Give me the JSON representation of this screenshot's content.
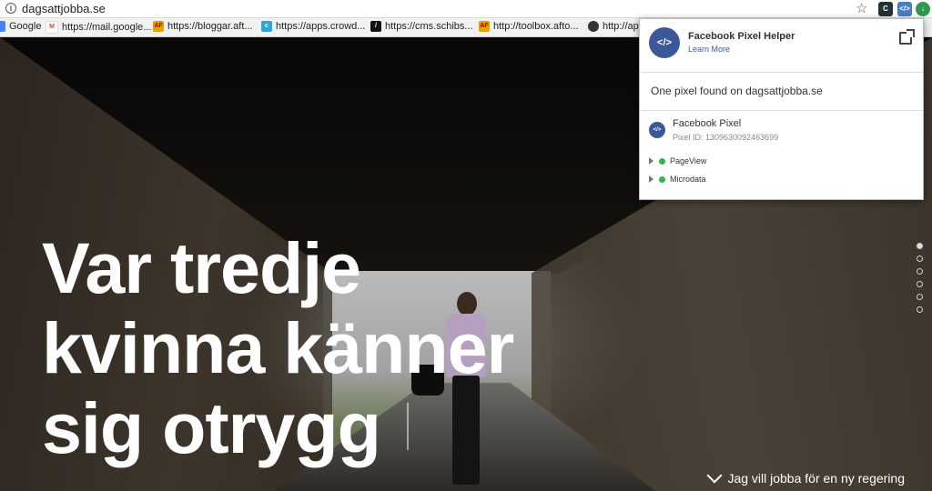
{
  "address_bar": {
    "url": "dagsattjobba.se",
    "info_icon": "info-icon",
    "star_icon": "star-icon",
    "extensions": [
      "C",
      "</>",
      "↓"
    ]
  },
  "bookmarks": [
    {
      "label": "Google",
      "icon": "apps-icon"
    },
    {
      "label": "https://mail.google...",
      "icon": "gmail-icon"
    },
    {
      "label": "https://bloggar.aft...",
      "icon": "af-icon"
    },
    {
      "label": "https://apps.crowd...",
      "icon": "crowd-icon"
    },
    {
      "label": "https://cms.schibs...",
      "icon": "schibsted-icon"
    },
    {
      "label": "http://toolbox.afto...",
      "icon": "af-icon"
    },
    {
      "label": "http://ap",
      "icon": "globe-icon"
    }
  ],
  "hero": {
    "headline": "Var tredje\nkvinna känner\nsig otrygg",
    "scroll_cta": "Jag vill jobba för en ny regering",
    "active_slide": 1,
    "slide_count": 6
  },
  "pixel_helper": {
    "title": "Facebook Pixel Helper",
    "learn_more": "Learn More",
    "summary": "One pixel found on dagsattjobba.se",
    "pixel_name": "Facebook Pixel",
    "pixel_id": "Pixel ID: 1309630092463699",
    "events": [
      "PageView",
      "Microdata"
    ],
    "brand_color": "#3b5998",
    "status_color": "#2fb34a"
  }
}
